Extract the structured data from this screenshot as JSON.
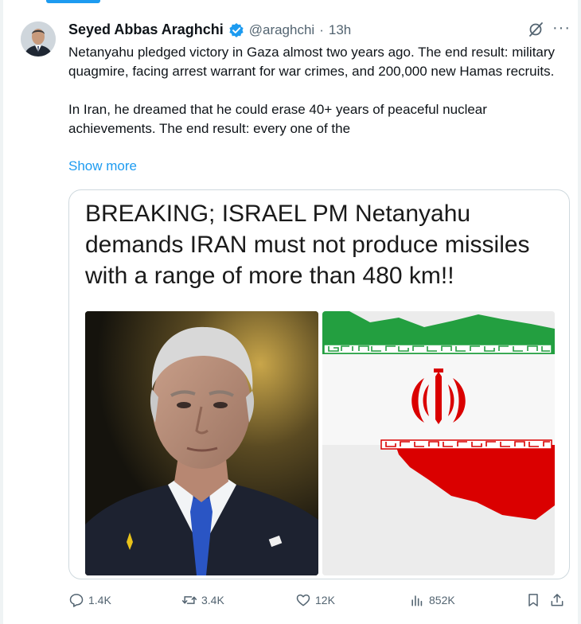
{
  "tweet": {
    "author_name": "Seyed Abbas Araghchi",
    "handle": "@araghchi",
    "separator": "·",
    "time": "13h",
    "more_glyph": "···",
    "paragraph1": "Netanyahu pledged victory in Gaza almost two years ago. The end result: military quagmire, facing arrest warrant for war crimes, and 200,000 new Hamas recruits.",
    "paragraph2": "In Iran, he dreamed that he could erase 40+ years of peaceful nuclear achievements. The end result: every one of the",
    "show_more": "Show more"
  },
  "card": {
    "headline": "BREAKING; ISRAEL PM Netanyahu demands  IRAN must not produce missiles with a range of more than 480 km!!"
  },
  "actions": {
    "replies": "1.4K",
    "reposts": "3.4K",
    "likes": "12K",
    "views": "852K"
  },
  "colors": {
    "accent": "#1d9bf0",
    "muted": "#536471",
    "border": "#cfd9de",
    "flag_green": "#239f40",
    "flag_red": "#da0000"
  }
}
